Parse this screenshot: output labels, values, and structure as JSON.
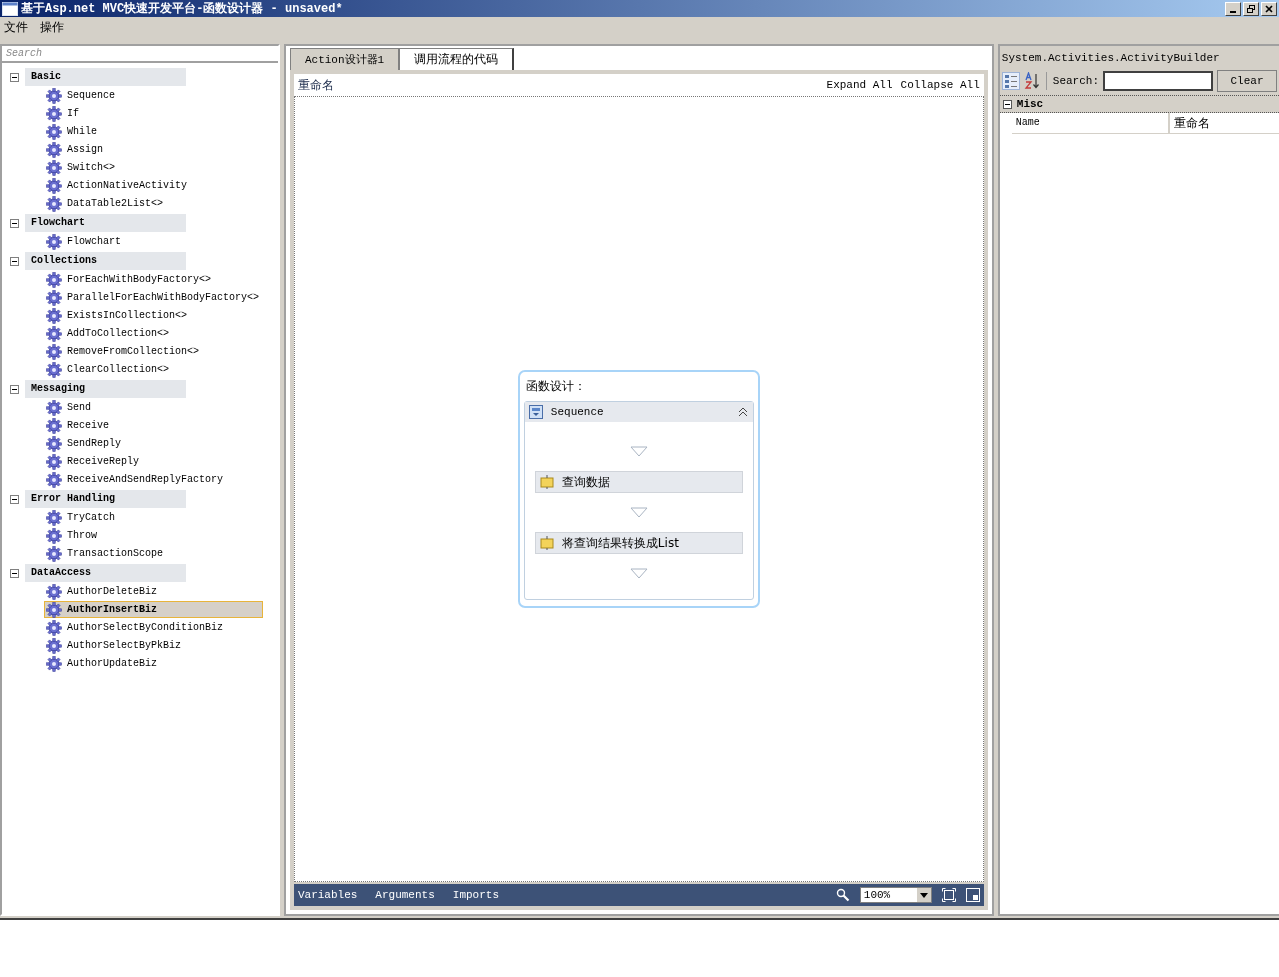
{
  "window": {
    "title": "基于Asp.net MVC快速开发平台-函数设计器 - unsaved*"
  },
  "menu": [
    "文件",
    "操作"
  ],
  "toolbox": {
    "search": {
      "placeholder": "Search"
    },
    "categories": [
      {
        "label": "Basic",
        "expanded": true,
        "children": [
          {
            "label": "Sequence",
            "selected": false
          },
          {
            "label": "If",
            "selected": false
          },
          {
            "label": "While",
            "selected": false
          },
          {
            "label": "Assign",
            "selected": false
          },
          {
            "label": "Switch<>",
            "selected": false
          },
          {
            "label": "ActionNativeActivity",
            "selected": false
          },
          {
            "label": "DataTable2List<>",
            "selected": false
          }
        ]
      },
      {
        "label": "Flowchart",
        "expanded": true,
        "children": [
          {
            "label": "Flowchart",
            "selected": false
          }
        ]
      },
      {
        "label": "Collections",
        "expanded": true,
        "children": [
          {
            "label": "ForEachWithBodyFactory<>",
            "selected": false
          },
          {
            "label": "ParallelForEachWithBodyFactory<>",
            "selected": false
          },
          {
            "label": "ExistsInCollection<>",
            "selected": false
          },
          {
            "label": "AddToCollection<>",
            "selected": false
          },
          {
            "label": "RemoveFromCollection<>",
            "selected": false
          },
          {
            "label": "ClearCollection<>",
            "selected": false
          }
        ]
      },
      {
        "label": "Messaging",
        "expanded": true,
        "children": [
          {
            "label": "Send",
            "selected": false
          },
          {
            "label": "Receive",
            "selected": false
          },
          {
            "label": "SendReply",
            "selected": false
          },
          {
            "label": "ReceiveReply",
            "selected": false
          },
          {
            "label": "ReceiveAndSendReplyFactory",
            "selected": false
          }
        ]
      },
      {
        "label": "Error Handling",
        "expanded": true,
        "children": [
          {
            "label": "TryCatch",
            "selected": false
          },
          {
            "label": "Throw",
            "selected": false
          },
          {
            "label": "TransactionScope",
            "selected": false
          }
        ]
      },
      {
        "label": "DataAccess",
        "expanded": true,
        "children": [
          {
            "label": "AuthorDeleteBiz",
            "selected": false
          },
          {
            "label": "AuthorInsertBiz",
            "selected": true
          },
          {
            "label": "AuthorSelectByConditionBiz",
            "selected": false
          },
          {
            "label": "AuthorSelectByPkBiz",
            "selected": false
          },
          {
            "label": "AuthorUpdateBiz",
            "selected": false
          }
        ]
      }
    ]
  },
  "tabs": [
    {
      "label": "Action设计器1",
      "selected": true
    },
    {
      "label": "调用流程的代码",
      "selected": false
    }
  ],
  "designer": {
    "breadcrumb": "重命名",
    "expand_all": "Expand All",
    "collapse_all": "Collapse All",
    "root": {
      "title": "函数设计：",
      "sequence": {
        "label": "Sequence",
        "activities": [
          "查询数据",
          "将查询结果转换成List"
        ]
      }
    },
    "footer": {
      "tabs": [
        "Variables",
        "Arguments",
        "Imports"
      ],
      "zoom": "100%"
    }
  },
  "properties": {
    "type": "System.Activities.ActivityBuilder",
    "search_label": "Search:",
    "clear": "Clear",
    "category": {
      "label": "Misc",
      "expanded": true
    },
    "rows": [
      {
        "name": "Name",
        "value": "重命名"
      }
    ]
  }
}
